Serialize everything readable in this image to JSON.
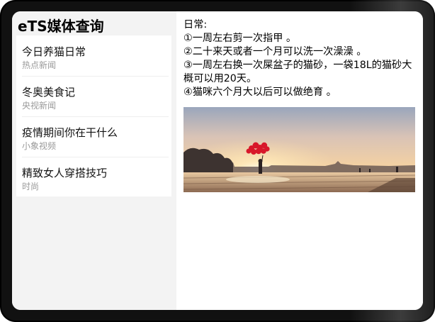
{
  "app": {
    "title": "eTS媒体查询"
  },
  "news": [
    {
      "title": "今日养猫日常",
      "source": "热点新闻"
    },
    {
      "title": "冬奥美食记",
      "source": "央视新闻"
    },
    {
      "title": "疫情期间你在干什么",
      "source": "小象视频"
    },
    {
      "title": "精致女人穿搭技巧",
      "source": "时尚"
    }
  ],
  "detail": {
    "heading": "日常:",
    "lines": [
      "①一周左右剪一次指甲 。",
      "②二十来天或者一个月可以洗一次澡澡 。",
      "③一周左右换一次屎盆子的猫砂，一袋18L的猫砂大概可以用20天。",
      "④猫咪六个月大以后可以做绝育 。"
    ],
    "image": "sunset-balloons-photo"
  },
  "colors": {
    "sidebar_bg": "#f3f3f3",
    "card_bg": "#ffffff",
    "source_text": "#9a9a9a",
    "device_frame": "#111111"
  }
}
